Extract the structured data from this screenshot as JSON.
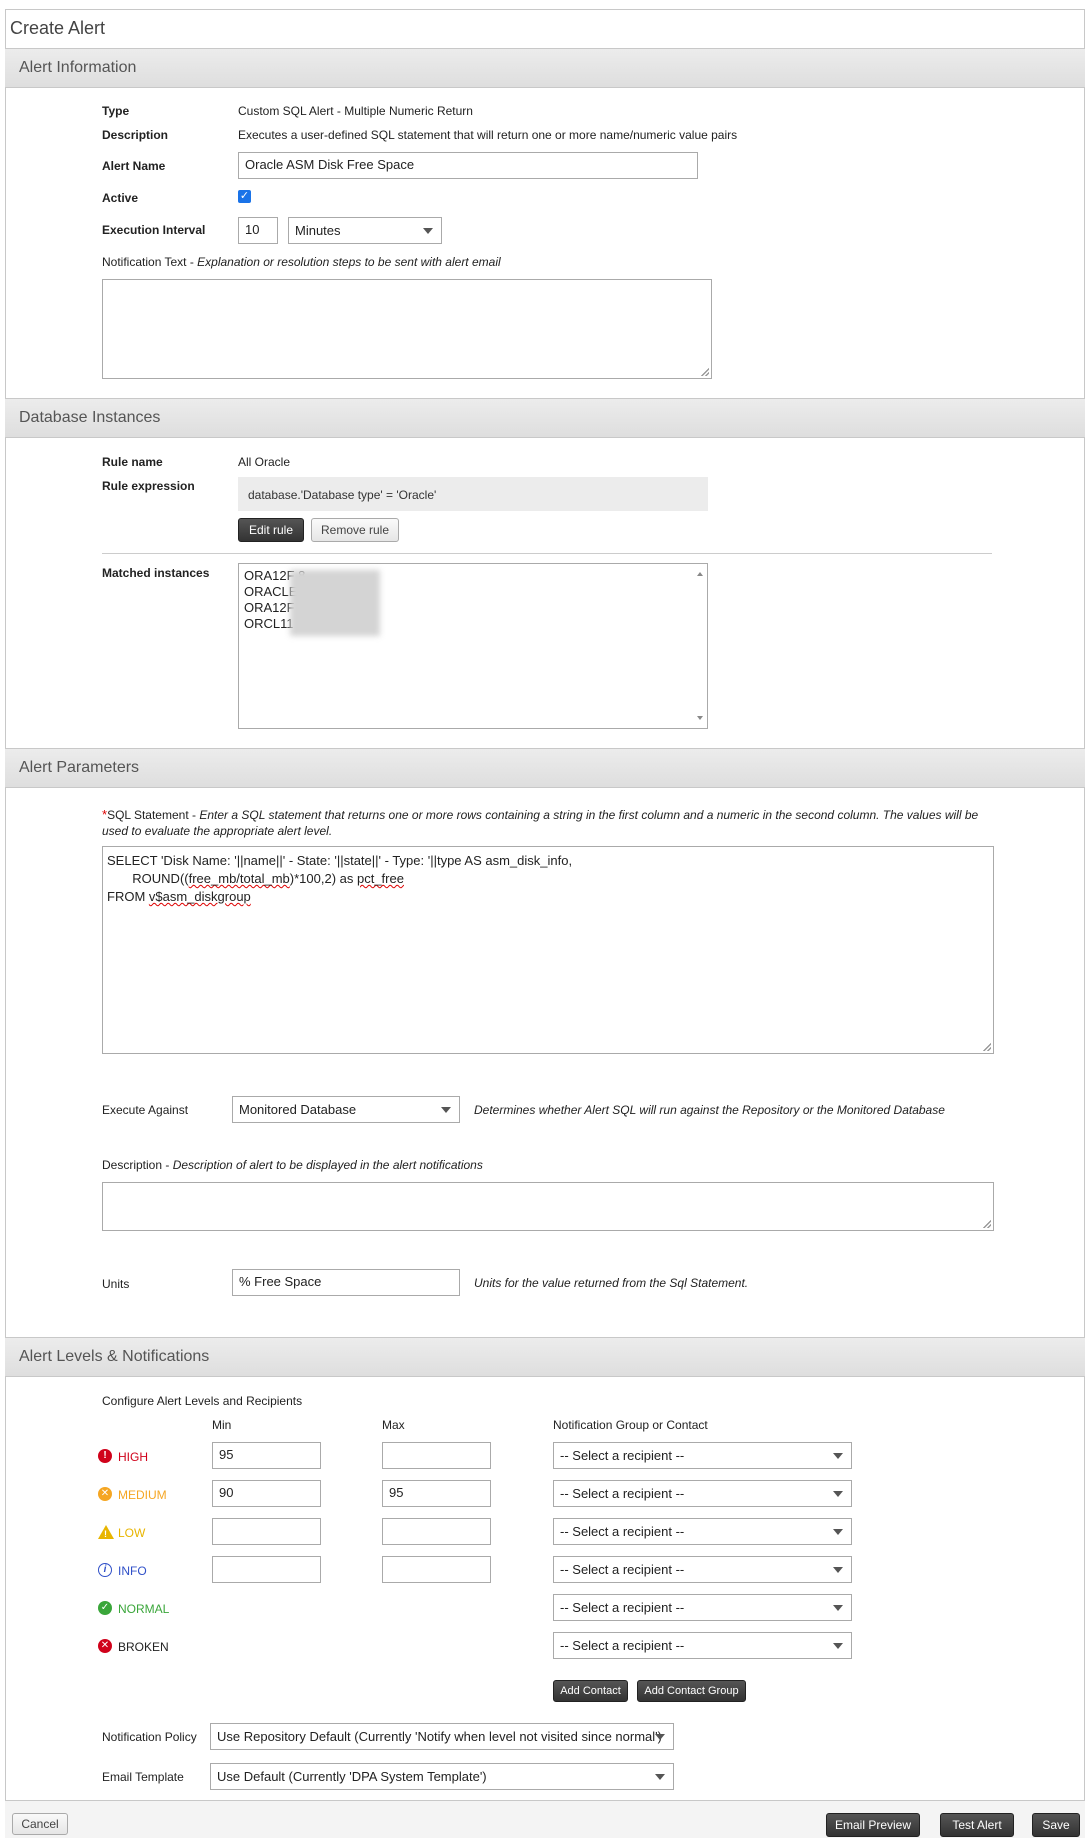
{
  "window": {
    "title": "Create Alert"
  },
  "sections": {
    "alert_info": "Alert Information",
    "db_instances": "Database Instances",
    "alert_params": "Alert Parameters",
    "alert_levels": "Alert Levels & Notifications"
  },
  "alert_info": {
    "type_label": "Type",
    "type_value": "Custom SQL Alert - Multiple Numeric Return",
    "description_label": "Description",
    "description_value": "Executes a user-defined SQL statement that will return one or more name/numeric value pairs",
    "name_label": "Alert Name",
    "name_value": "Oracle ASM Disk Free Space",
    "active_label": "Active",
    "active_checked": true,
    "interval_label": "Execution Interval",
    "interval_value": "10",
    "interval_unit": "Minutes",
    "notification_label": "Notification Text - ",
    "notification_hint": "Explanation or resolution steps to be sent with alert email"
  },
  "db_instances": {
    "rule_name_label": "Rule name",
    "rule_name_value": "All Oracle",
    "rule_expr_label": "Rule expression",
    "rule_expr_value": "database.'Database type' = 'Oracle'",
    "edit_rule": "Edit rule",
    "remove_rule": "Remove rule",
    "matched_label": "Matched instances",
    "matched": [
      "ORA12F                    8",
      "ORACLE",
      "ORA12F                    7 - AWS IA",
      "ORCL11                     N1"
    ]
  },
  "alert_params": {
    "sql_label": "SQL Statement - ",
    "sql_hint": "Enter a SQL statement that returns one or more rows containing a string in the first column and a numeric in the second column. The values will be used to evaluate the appropriate alert level.",
    "sql_line1": "SELECT 'Disk Name: '||name||' - State: '||state||' - Type: '||type AS asm_disk_info,",
    "sql_line2_a": "       ROUND((",
    "sql_line2_b": "free_mb/total_mb",
    "sql_line2_c": ")*100,2) as ",
    "sql_line2_d": "pct_free",
    "sql_line3_a": "FROM ",
    "sql_line3_b": "v$asm_diskgroup",
    "exec_label": "Execute Against",
    "exec_value": "Monitored Database",
    "exec_hint": "Determines whether Alert SQL will run against the Repository or the Monitored Database",
    "desc_label": "Description - ",
    "desc_hint": "Description of alert to be displayed in the alert notifications",
    "units_label": "Units",
    "units_value": "% Free Space",
    "units_hint": "Units for the value returned from the Sql Statement."
  },
  "alert_levels": {
    "configure_label": "Configure Alert Levels and Recipients",
    "col_min": "Min",
    "col_max": "Max",
    "col_group": "Notification Group or Contact",
    "recipient_placeholder": "-- Select a recipient --",
    "levels": [
      {
        "name": "HIGH",
        "min": "95",
        "max": "",
        "color": "#d0021b"
      },
      {
        "name": "MEDIUM",
        "min": "90",
        "max": "95",
        "color": "#f5a623"
      },
      {
        "name": "LOW",
        "min": "",
        "max": "",
        "color": "#e8b500"
      },
      {
        "name": "INFO",
        "min": "",
        "max": "",
        "color": "#3050c8"
      },
      {
        "name": "NORMAL",
        "color": "#3aa63a"
      },
      {
        "name": "BROKEN",
        "color": "#d0021b"
      }
    ],
    "add_contact": "Add Contact",
    "add_contact_group": "Add Contact Group",
    "policy_label": "Notification Policy",
    "policy_value": "Use Repository Default (Currently 'Notify when level not visited since normal')",
    "template_label": "Email Template",
    "template_value": "Use Default (Currently 'DPA System Template')"
  },
  "footer": {
    "cancel": "Cancel",
    "email_preview": "Email Preview",
    "test_alert": "Test Alert",
    "save": "Save"
  }
}
